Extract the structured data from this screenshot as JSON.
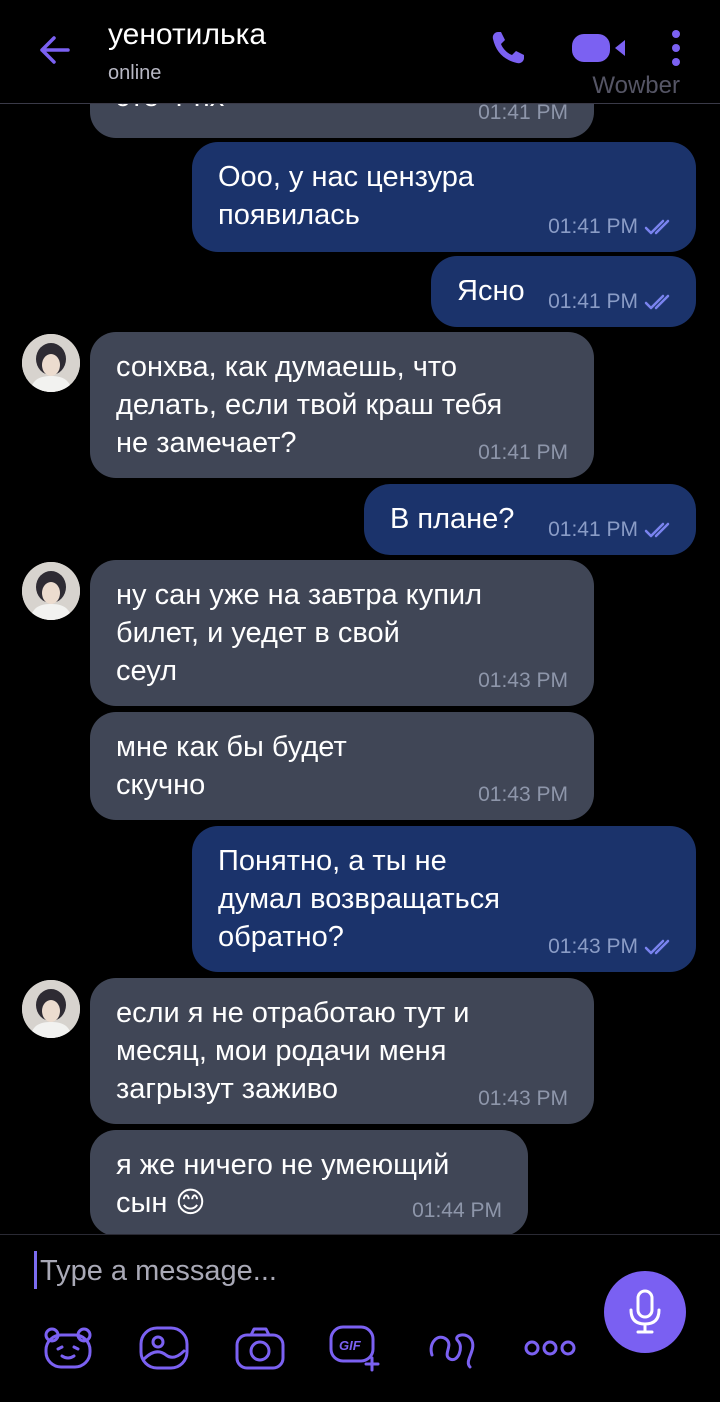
{
  "header": {
    "title": "уенотилька",
    "status": "online",
    "watermark": "Wowber",
    "icons": [
      "back-arrow-icon",
      "phone-icon",
      "video-icon",
      "more-vertical-icon"
    ],
    "accent_color": "#7b61f2"
  },
  "messages": [
    {
      "dir": "in",
      "text": "это ч*нх*",
      "time": "01:41 PM"
    },
    {
      "dir": "out",
      "text": "Ооо, у нас цензура\nпоявилась",
      "time": "01:41 PM",
      "read": true
    },
    {
      "dir": "out",
      "text": "Ясно",
      "time": "01:41 PM",
      "read": true
    },
    {
      "dir": "in",
      "text": "сонхва, как думаешь, что\nделать, если твой краш тебя\nне замечает?",
      "time": "01:41 PM",
      "avatar": true
    },
    {
      "dir": "out",
      "text": "В плане?",
      "time": "01:41 PM",
      "read": true
    },
    {
      "dir": "in",
      "text": "ну сан уже на завтра купил\nбилет, и уедет в свой\nсеул",
      "time": "01:43 PM",
      "avatar": true
    },
    {
      "dir": "in",
      "text": "мне как бы будет\nскучно",
      "time": "01:43 PM"
    },
    {
      "dir": "out",
      "text": "Понятно, а ты не\nдумал возвращаться\nобратно?",
      "time": "01:43 PM",
      "read": true
    },
    {
      "dir": "in",
      "text": "если я не отработаю тут и\nмесяц, мои родачи меня\nзагрызут заживо",
      "time": "01:43 PM",
      "avatar": true
    },
    {
      "dir": "in",
      "text": "я же ничего не умеющий\nсын 😊",
      "time": "01:44 PM"
    }
  ],
  "input": {
    "placeholder": "Type a message..."
  },
  "toolbar": {
    "icons": [
      "sticker-bear-icon",
      "image-icon",
      "camera-icon",
      "gif-icon",
      "doodle-icon",
      "more-horizontal-icon",
      "microphone-icon"
    ]
  },
  "colors": {
    "incoming_bubble": "#404656",
    "outgoing_bubble": "#1b336b",
    "mic_button": "#7a60f2"
  }
}
